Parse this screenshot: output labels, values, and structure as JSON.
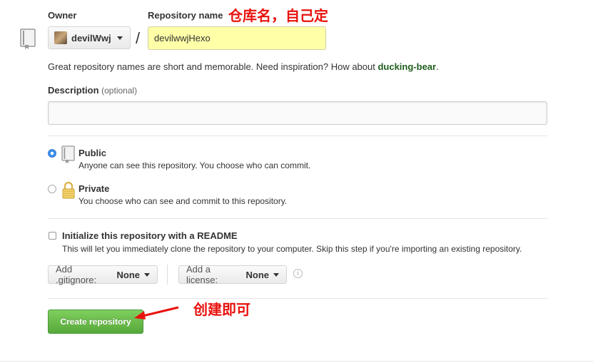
{
  "owner": {
    "label": "Owner",
    "value": "devilWwj"
  },
  "repo_name": {
    "label": "Repository name",
    "value": "devilwwjHexo",
    "separator": "/"
  },
  "annotations": {
    "top": "仓库名，自己定",
    "bottom": "创建即可"
  },
  "hint": {
    "text": "Great repository names are short and memorable. Need inspiration? How about ",
    "suggestion": "ducking-bear",
    "end": "."
  },
  "description": {
    "label": "Description",
    "optional": "(optional)",
    "value": ""
  },
  "visibility": {
    "public": {
      "title": "Public",
      "subtitle": "Anyone can see this repository. You choose who can commit.",
      "selected": true
    },
    "private": {
      "title": "Private",
      "subtitle": "You choose who can see and commit to this repository.",
      "selected": false
    }
  },
  "readme": {
    "title": "Initialize this repository with a README",
    "subtitle": "This will let you immediately clone the repository to your computer. Skip this step if you're importing an existing repository.",
    "checked": false
  },
  "gitignore": {
    "prefix": "Add .gitignore:",
    "value": "None"
  },
  "license": {
    "prefix": "Add a license:",
    "value": "None"
  },
  "create_button": "Create repository",
  "colors": {
    "accent_green": "#57a83b",
    "annotation_red": "#e8120d",
    "input_highlight": "#ffffa8"
  }
}
